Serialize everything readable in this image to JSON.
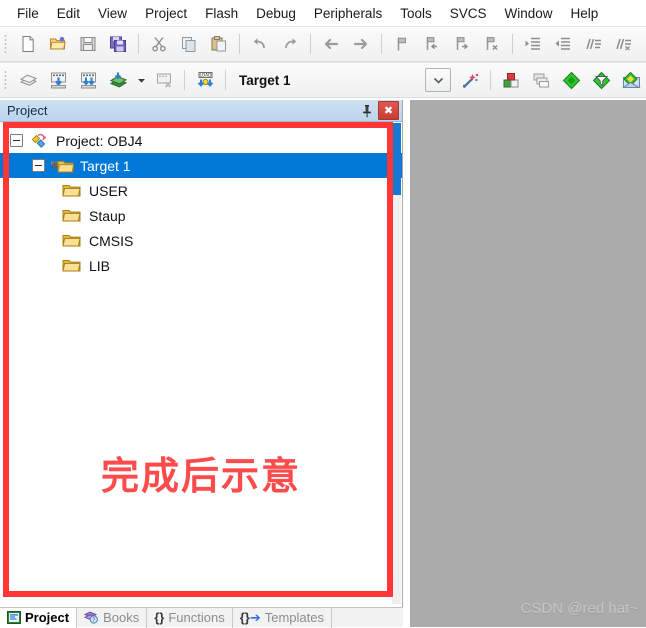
{
  "menu": {
    "items": [
      {
        "label": "File"
      },
      {
        "label": "Edit"
      },
      {
        "label": "View"
      },
      {
        "label": "Project"
      },
      {
        "label": "Flash"
      },
      {
        "label": "Debug"
      },
      {
        "label": "Peripherals"
      },
      {
        "label": "Tools"
      },
      {
        "label": "SVCS"
      },
      {
        "label": "Window"
      },
      {
        "label": "Help"
      }
    ]
  },
  "toolbar_main": {
    "buttons": [
      {
        "name": "new-file-icon",
        "title": "New"
      },
      {
        "name": "open-folder-icon",
        "title": "Open"
      },
      {
        "name": "save-icon",
        "title": "Save"
      },
      {
        "name": "save-all-icon",
        "title": "Save All"
      },
      {
        "name": "cut-icon",
        "title": "Cut"
      },
      {
        "name": "copy-icon",
        "title": "Copy"
      },
      {
        "name": "paste-icon",
        "title": "Paste"
      },
      {
        "name": "undo-icon",
        "title": "Undo"
      },
      {
        "name": "redo-icon",
        "title": "Redo"
      },
      {
        "name": "back-arrow-icon",
        "title": "Back"
      },
      {
        "name": "forward-arrow-icon",
        "title": "Forward"
      },
      {
        "name": "bookmark-icon",
        "title": "Insert/Remove Bookmark"
      },
      {
        "name": "bookmark-prev-icon",
        "title": "Previous Bookmark"
      },
      {
        "name": "bookmark-next-icon",
        "title": "Next Bookmark"
      },
      {
        "name": "bookmark-clear-icon",
        "title": "Clear All Bookmarks"
      },
      {
        "name": "indent-right-icon",
        "title": "Indent Selected Text"
      },
      {
        "name": "indent-left-icon",
        "title": "Unindent Selected Text"
      },
      {
        "name": "comment-icon",
        "title": "Comment Selection"
      },
      {
        "name": "uncomment-icon",
        "title": "Uncomment Selection"
      }
    ]
  },
  "toolbar_build": {
    "buttons": [
      {
        "name": "translate-icon",
        "title": "Translate"
      },
      {
        "name": "build-icon",
        "title": "Build"
      },
      {
        "name": "rebuild-icon",
        "title": "Rebuild"
      },
      {
        "name": "batch-build-icon",
        "title": "Batch Build"
      },
      {
        "name": "stop-build-icon",
        "title": "Stop Build"
      },
      {
        "name": "download-icon",
        "title": "Download"
      }
    ],
    "target_value": "Target 1",
    "target_dropdown_icon": "chevron-down-icon",
    "right_buttons": [
      {
        "name": "magic-wand-icon",
        "title": "Configure Target"
      },
      {
        "name": "target-options-icon",
        "title": "Options for Target"
      },
      {
        "name": "manage-components-icon",
        "title": "Manage Components"
      },
      {
        "name": "green-diamond-icon",
        "title": "Start Debug Session"
      },
      {
        "name": "filter-diamond-icon",
        "title": "Packs"
      },
      {
        "name": "pack-installer-icon",
        "title": "Pack Installer"
      }
    ]
  },
  "project_panel": {
    "title": "Project",
    "pin_icon": "pushpin-icon",
    "close_icon": "close-icon",
    "tree": [
      {
        "label": "Project: OBJ4",
        "icon": "project-root-icon",
        "level": 0,
        "expanded": true,
        "selected": false
      },
      {
        "label": "Target 1",
        "icon": "target-folder-icon",
        "level": 1,
        "expanded": true,
        "selected": true
      },
      {
        "label": "USER",
        "icon": "folder-icon",
        "level": 2,
        "expanded": false,
        "selected": false
      },
      {
        "label": "Staup",
        "icon": "folder-icon",
        "level": 2,
        "expanded": false,
        "selected": false
      },
      {
        "label": "CMSIS",
        "icon": "folder-icon",
        "level": 2,
        "expanded": false,
        "selected": false
      },
      {
        "label": "LIB",
        "icon": "folder-icon",
        "level": 2,
        "expanded": false,
        "selected": false
      }
    ],
    "annotation_text": "完成后示意",
    "annotation_color": "#fd4a4a",
    "highlight_box_color": "#fd3535",
    "selection_color": "#0078d7"
  },
  "bottom_tabs": [
    {
      "label": "Project",
      "icon": "project-tab-icon",
      "active": true
    },
    {
      "label": "Books",
      "icon": "books-icon",
      "active": false
    },
    {
      "label": "Functions",
      "icon": "functions-icon",
      "active": false
    },
    {
      "label": "Templates",
      "icon": "templates-icon",
      "active": false
    }
  ],
  "editor_area": {
    "watermark": "CSDN @red hat~",
    "background_color": "#ababab"
  }
}
